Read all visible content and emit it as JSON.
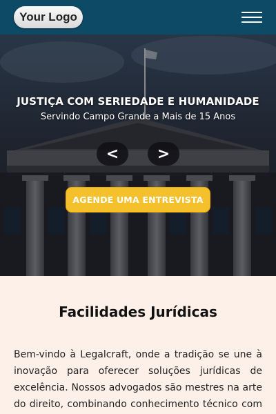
{
  "header": {
    "logo_text": "Your Logo",
    "menu_icon": "hamburger-menu-icon",
    "background": "#0d4a66"
  },
  "hero": {
    "title": "JUSTIÇA COM SERIEDADE E HUMANIDADE",
    "subtitle": "Servindo Campo Grande a Mais de 15 Anos",
    "prev_label": "<",
    "next_label": ">",
    "cta_label": "AGENDE UMA ENTREVISTA",
    "cta_color": "#f4c02c"
  },
  "main": {
    "section_title": "Facilidades Jurídicas",
    "intro_text": "Bem-vindo à Legalcraft, onde a tradição se une à inovação para oferecer soluções jurídicas de excelência. Nossos advogados são mestres na arte do direito, combinando conhecimento técnico com uma"
  },
  "colors": {
    "page_background": "#fdf0e8"
  }
}
